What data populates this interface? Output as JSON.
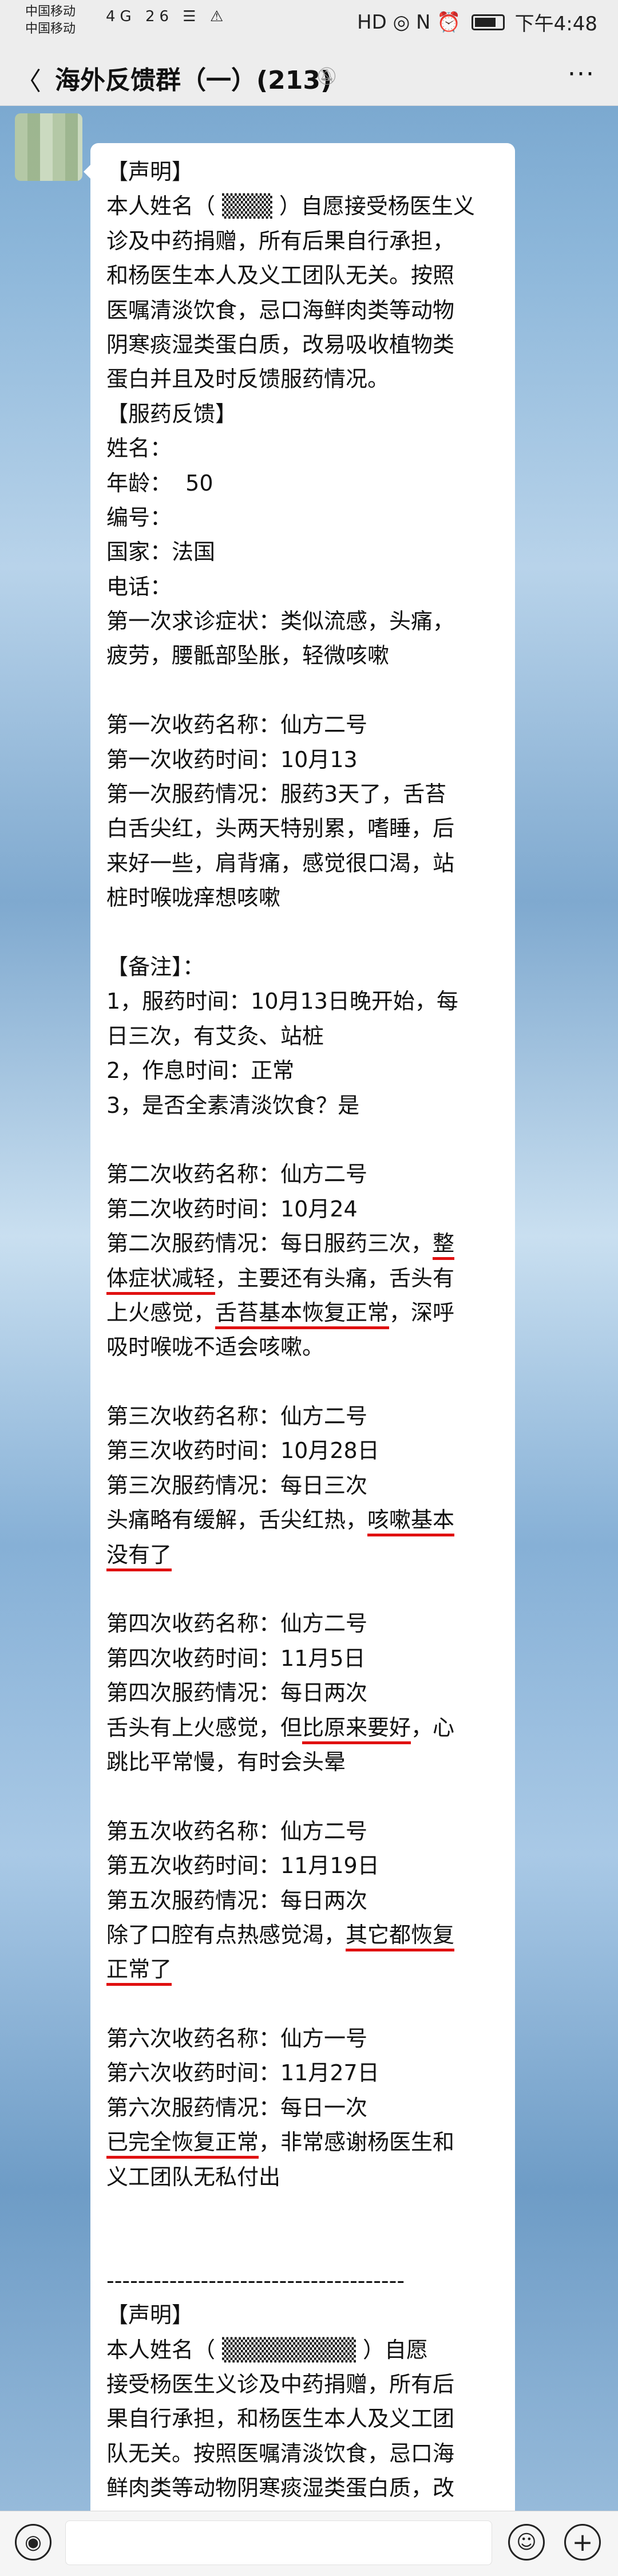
{
  "status_bar": {
    "carrier_1": "中国移动",
    "carrier_2": "中国移动",
    "signal_icons": "4G 26 ☰ ⚠",
    "right_icons": "HD ◎ N ⏰",
    "time": "下午4:48"
  },
  "header": {
    "back_icon": "chevron-left-icon",
    "title": "海外反馈群（一）(213)",
    "mute_icon": "bell-off-icon",
    "more_icon": "more-icon",
    "more_label": "···"
  },
  "message": {
    "lines": [
      "【声明】",
      "本人姓名（ ▒▒▒ ）自愿接受杨医生义",
      "诊及中药捐赠，所有后果自行承担，",
      "和杨医生本人及义工团队无关。按照",
      "医嘱清淡饮食，忌口海鲜肉类等动物",
      "阴寒痰湿类蛋白质，改易吸收植物类",
      "蛋白并且及时反馈服药情况。",
      "【服药反馈】",
      "姓名：",
      "年龄：  50",
      "编号：",
      "国家：法国",
      "电话：",
      "第一次求诊症状：类似流感，头痛，",
      "疲劳，腰骶部坠胀，轻微咳嗽",
      "",
      "第一次收药名称：仙方二号",
      "第一次收药时间：10月13",
      "第一次服药情况：服药3天了，舌苔",
      "白舌尖红，头两天特别累，嗜睡，后",
      "来好一些，肩背痛，感觉很口渴，站",
      "桩时喉咙痒想咳嗽",
      "",
      "【备注】：",
      "1，服药时间：10月13日晚开始，每",
      "日三次，有艾灸、站桩",
      "2，作息时间：正常",
      "3，是否全素清淡饮食？是",
      "",
      "第二次收药名称：仙方二号",
      "第二次收药时间：10月24",
      "第二次服药情况：每日服药三次，整",
      "体症状减轻，主要还有头痛，舌头有",
      "上火感觉，舌苔基本恢复正常，深呼",
      "吸时喉咙不适会咳嗽。",
      "",
      "第三次收药名称：仙方二号",
      "第三次收药时间：10月28日",
      "第三次服药情况：每日三次",
      "头痛略有缓解，舌尖红热，咳嗽基本",
      "没有了",
      "",
      "第四次收药名称：仙方二号",
      "第四次收药时间：11月5日",
      "第四次服药情况：每日两次",
      "舌头有上火感觉，但比原来要好，心",
      "跳比平常慢，有时会头晕",
      "",
      "第五次收药名称：仙方二号",
      "第五次收药时间：11月19日",
      "第五次服药情况：每日两次",
      "除了口腔有点热感觉渴，其它都恢复",
      "正常了",
      "",
      "第六次收药名称：仙方一号",
      "第六次收药时间：11月27日",
      "第六次服药情况：每日一次",
      "已完全恢复正常，非常感谢杨医生和",
      "义工团队无私付出",
      "",
      "",
      "--------------------------------------",
      "【声明】",
      "本人姓名（ ▒▒▒▒▒▒▒▒ ）自愿",
      "接受杨医生义诊及中药捐赠，所有后",
      "果自行承担，和杨医生本人及义工团",
      "队无关。按照医嘱清淡饮食，忌口海",
      "鲜肉类等动物阴寒痰湿类蛋白质，改"
    ]
  },
  "underlines": [
    {
      "line": 31,
      "text": "整"
    },
    {
      "line": 32,
      "text": "体症状减轻"
    },
    {
      "line": 33,
      "text": "舌苔基本恢复正常"
    },
    {
      "line": 39,
      "text": "咳嗽基本"
    },
    {
      "line": 40,
      "text": "没有了"
    },
    {
      "line": 45,
      "text": "比原来要好"
    },
    {
      "line": 51,
      "text": "其它都恢复"
    },
    {
      "line": 52,
      "text": "正常了"
    },
    {
      "line": 57,
      "text": "已完全恢复正常"
    }
  ],
  "bottom_bar": {
    "voice_icon": "voice-icon",
    "emoji_icon": "emoji-icon",
    "plus_icon": "plus-icon"
  },
  "colors": {
    "underline": "#e01010",
    "bar_bg": "#ededed"
  }
}
